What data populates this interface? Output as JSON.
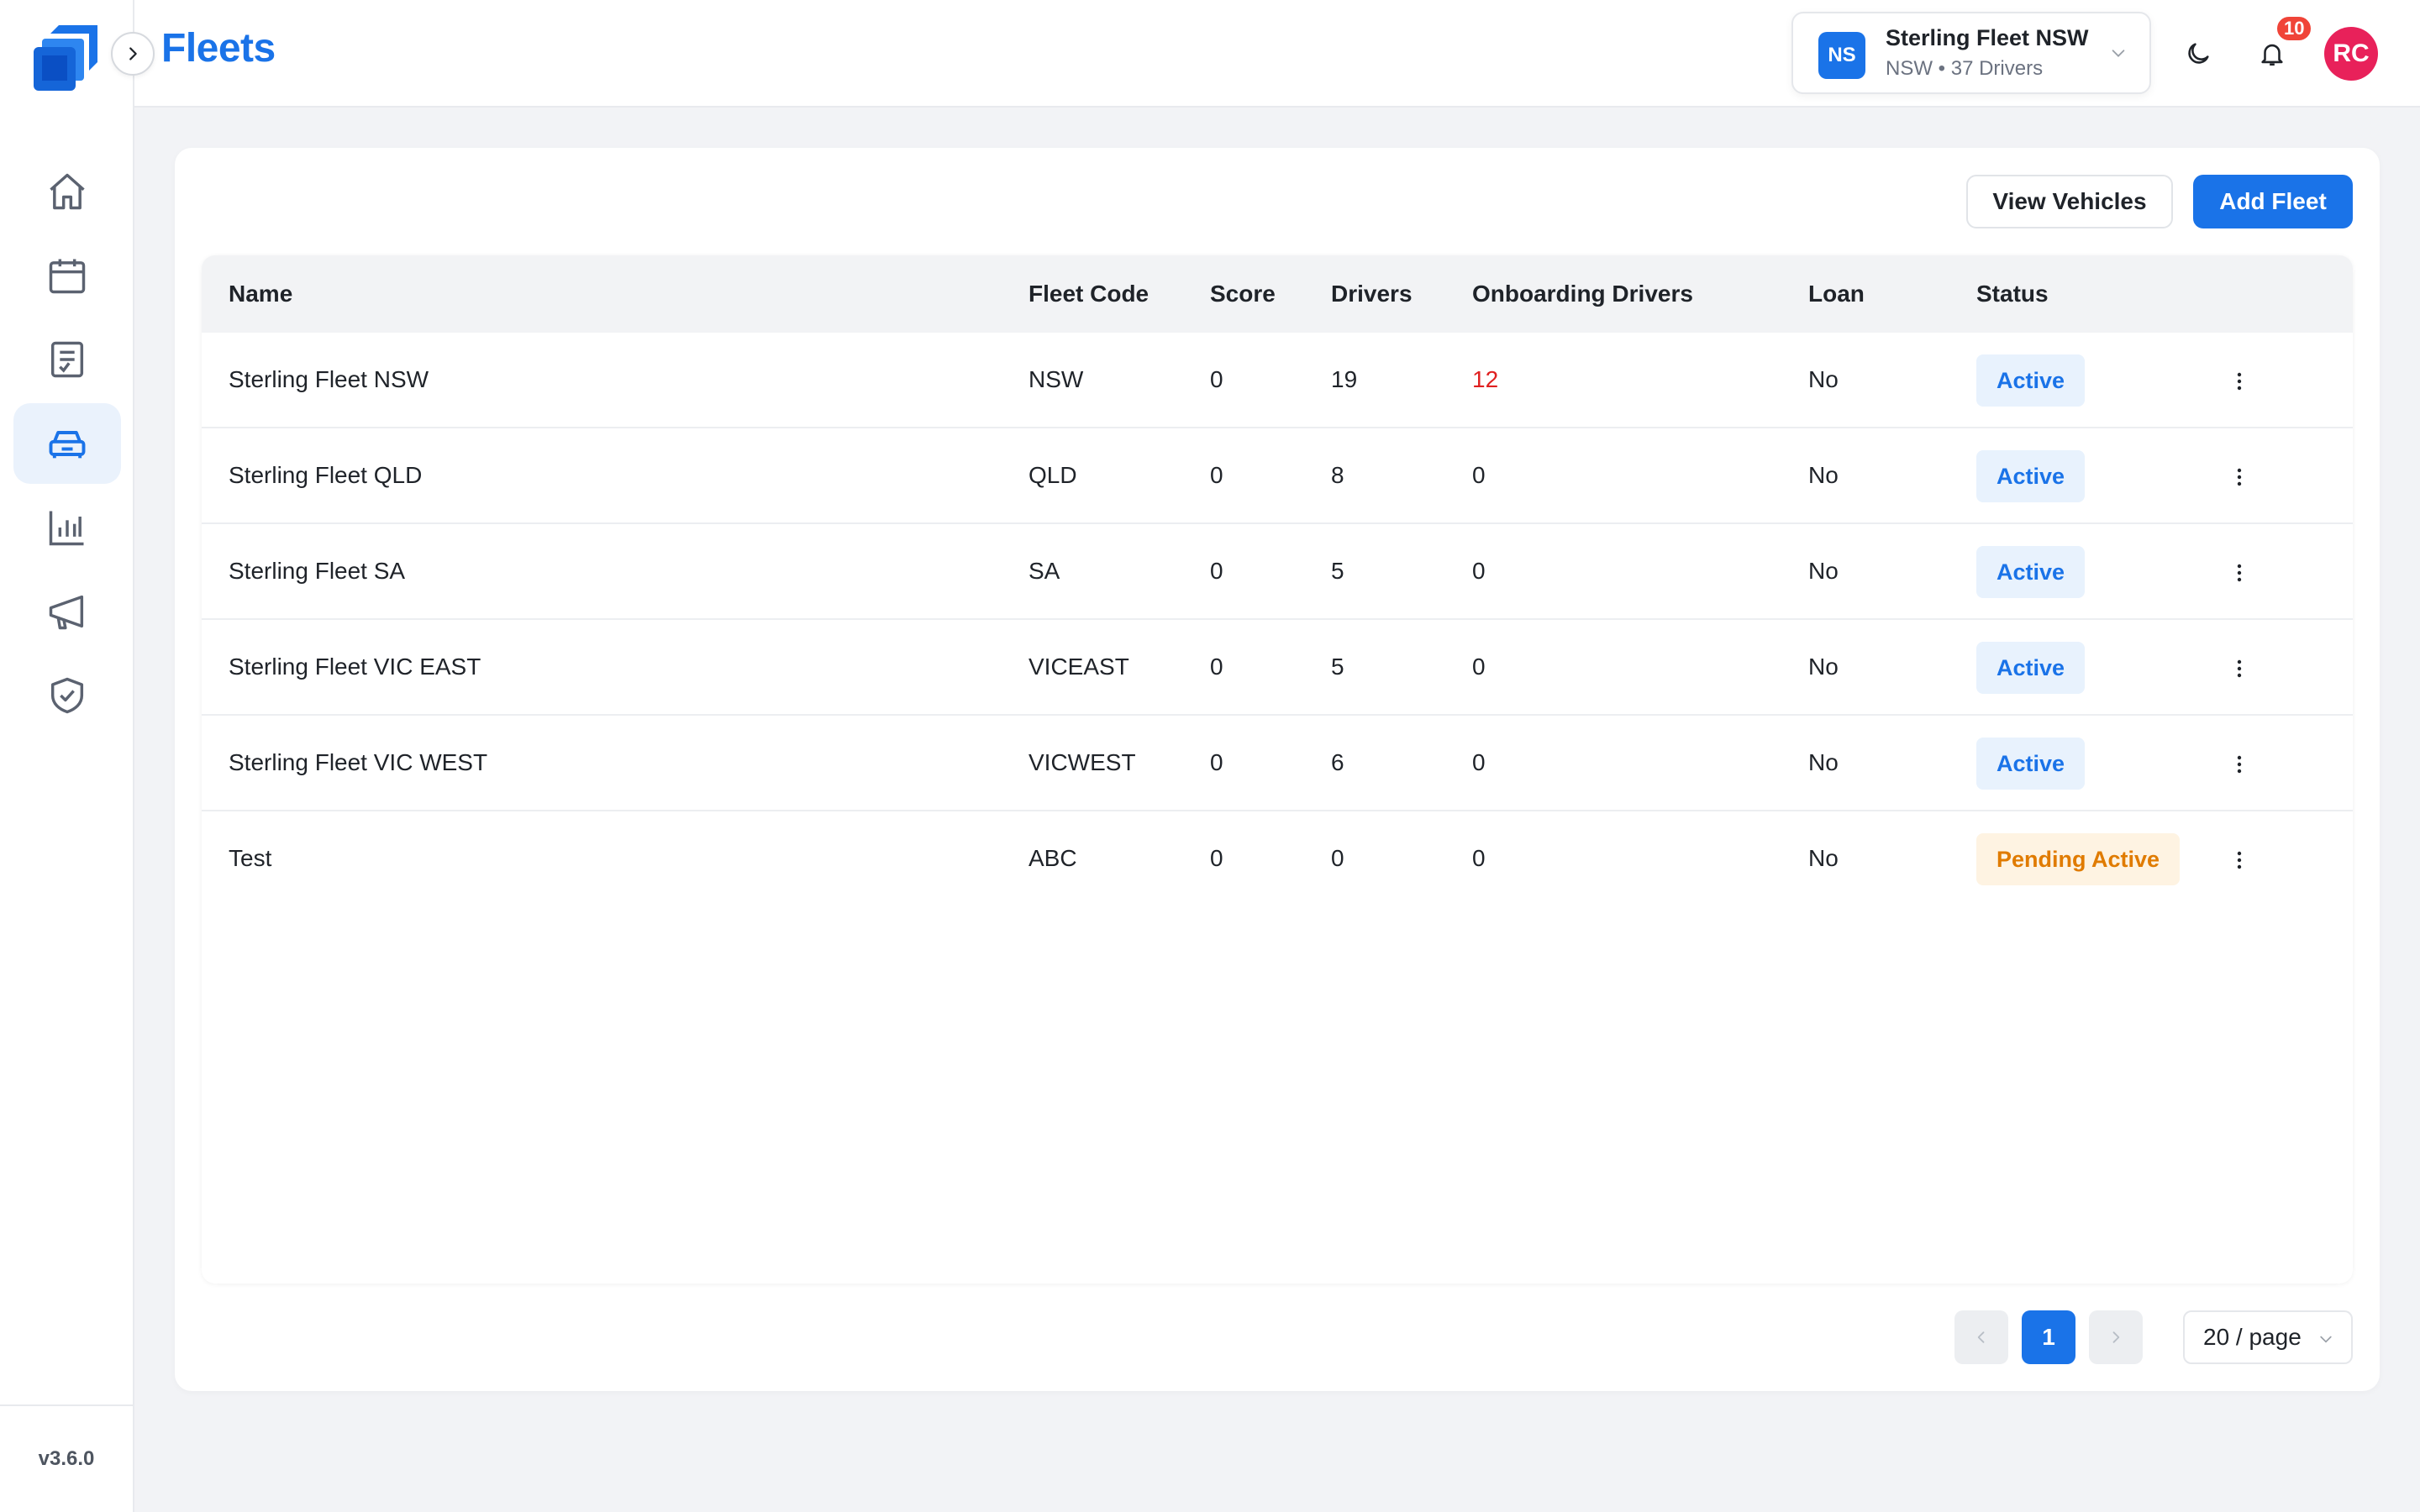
{
  "app": {
    "title": "Fleets",
    "version": "v3.6.0"
  },
  "sidebar": {
    "items": [
      {
        "icon": "home-icon"
      },
      {
        "icon": "calendar-icon"
      },
      {
        "icon": "document-icon"
      },
      {
        "icon": "car-icon",
        "active": true
      },
      {
        "icon": "bar-chart-icon"
      },
      {
        "icon": "megaphone-icon"
      },
      {
        "icon": "shield-check-icon"
      }
    ]
  },
  "header": {
    "fleet_switcher": {
      "badge": "NS",
      "name": "Sterling Fleet NSW",
      "subtitle": "NSW • 37 Drivers"
    },
    "notification_count": "10",
    "avatar_initials": "RC"
  },
  "toolbar": {
    "view_vehicles": "View Vehicles",
    "add_fleet": "Add Fleet"
  },
  "table": {
    "columns": [
      "Name",
      "Fleet Code",
      "Score",
      "Drivers",
      "Onboarding Drivers",
      "Loan",
      "Status"
    ],
    "rows": [
      {
        "name": "Sterling Fleet NSW",
        "code": "NSW",
        "score": "0",
        "drivers": "19",
        "onboarding": "12",
        "loan": "No",
        "status": "Active",
        "status_type": "active"
      },
      {
        "name": "Sterling Fleet QLD",
        "code": "QLD",
        "score": "0",
        "drivers": "8",
        "onboarding": "0",
        "loan": "No",
        "status": "Active",
        "status_type": "active"
      },
      {
        "name": "Sterling Fleet SA",
        "code": "SA",
        "score": "0",
        "drivers": "5",
        "onboarding": "0",
        "loan": "No",
        "status": "Active",
        "status_type": "active"
      },
      {
        "name": "Sterling Fleet VIC EAST",
        "code": "VICEAST",
        "score": "0",
        "drivers": "5",
        "onboarding": "0",
        "loan": "No",
        "status": "Active",
        "status_type": "active"
      },
      {
        "name": "Sterling Fleet VIC WEST",
        "code": "VICWEST",
        "score": "0",
        "drivers": "6",
        "onboarding": "0",
        "loan": "No",
        "status": "Active",
        "status_type": "active"
      },
      {
        "name": "Test",
        "code": "ABC",
        "score": "0",
        "drivers": "0",
        "onboarding": "0",
        "loan": "No",
        "status": "Pending Active",
        "status_type": "pending"
      }
    ]
  },
  "pagination": {
    "current_page": "1",
    "page_size": "20 / page"
  },
  "colors": {
    "accent": "#1a73e8",
    "danger": "#e02020",
    "pending": "#e07b00",
    "avatar": "#e8215a"
  }
}
